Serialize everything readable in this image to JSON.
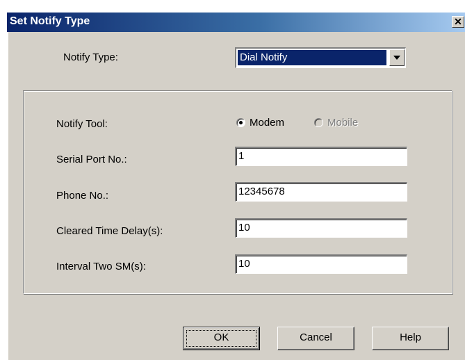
{
  "window": {
    "title": "Set Notify Type",
    "close_glyph": "✕"
  },
  "notify_type": {
    "label": "Notify Type:",
    "value": "Dial Notify"
  },
  "notify_tool": {
    "label": "Notify Tool:",
    "options": [
      {
        "label": "Modem",
        "selected": true,
        "enabled": true
      },
      {
        "label": "Mobile",
        "selected": false,
        "enabled": false
      }
    ]
  },
  "fields": {
    "serial_port": {
      "label": "Serial Port No.:",
      "value": "1"
    },
    "phone": {
      "label": "Phone No.:",
      "value": "12345678"
    },
    "cleared_delay": {
      "label": "Cleared Time Delay(s):",
      "value": "10"
    },
    "interval_sm": {
      "label": "Interval Two SM(s):",
      "value": "10"
    }
  },
  "buttons": {
    "ok": "OK",
    "cancel": "Cancel",
    "help": "Help"
  },
  "colors": {
    "face": "#d4d0c8",
    "title_start": "#0a246a",
    "title_end": "#a6caf0",
    "selection": "#0a246a"
  }
}
